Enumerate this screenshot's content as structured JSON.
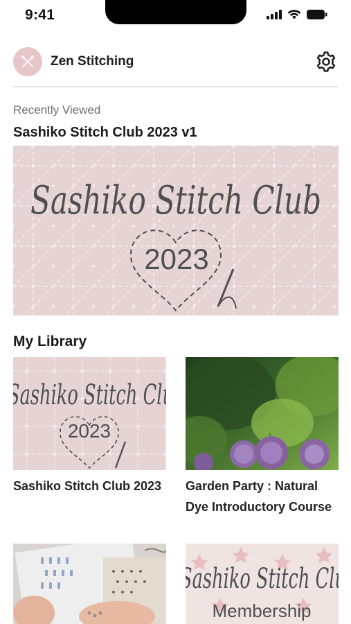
{
  "status_bar": {
    "time": "9:41"
  },
  "header": {
    "brand": "Zen Stitching",
    "settings_icon": "gear-icon",
    "avatar_icon": "needle-logo-icon"
  },
  "recent": {
    "label": "Recently Viewed",
    "title": "Sashiko Stitch Club 2023 v1",
    "image_text": {
      "script": "Sashiko Stitch Club",
      "year": "2023"
    }
  },
  "library": {
    "heading": "My Library",
    "items": [
      {
        "title": "Sashiko Stitch Club 2023",
        "image_script": "Sashiko Stitch Clu",
        "image_year": "2023"
      },
      {
        "title": "Garden Party : Natural Dye Introductory Course"
      },
      {
        "title": ""
      },
      {
        "title": "",
        "image_script": "Sashiko Stitch Clu",
        "image_subtitle": "Membership"
      }
    ]
  },
  "colors": {
    "thumb_pink": "#e6d3d3",
    "script_text": "#4f4f52",
    "avatar_pink": "#e7c5c9",
    "divider": "#e6e6e6"
  }
}
